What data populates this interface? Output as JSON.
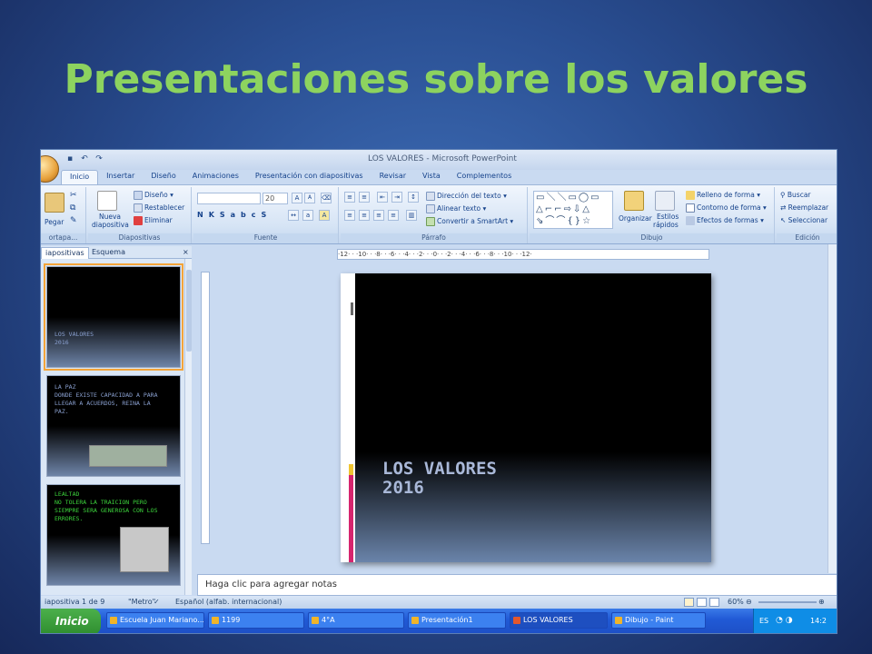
{
  "page": {
    "title": "Presentaciones sobre los valores"
  },
  "window": {
    "title": "LOS VALORES - Microsoft PowerPoint"
  },
  "ribbon_tabs": [
    "Inicio",
    "Insertar",
    "Diseño",
    "Animaciones",
    "Presentación con diapositivas",
    "Revisar",
    "Vista",
    "Complementos"
  ],
  "ribbon": {
    "portapapeles": {
      "label": "ortapa...",
      "pegar": "Pegar"
    },
    "diapositivas": {
      "label": "Diapositivas",
      "nueva_line1": "Nueva",
      "nueva_line2": "diapositiva",
      "diseno": "Diseño",
      "restablecer": "Restablecer",
      "eliminar": "Eliminar"
    },
    "fuente": {
      "label": "Fuente",
      "size": "20",
      "grow": "A",
      "shrink": "A"
    },
    "parrafo": {
      "label": "Párrafo",
      "direccion": "Dirección del texto",
      "alinear": "Alinear texto",
      "convertir": "Convertir a SmartArt"
    },
    "dibujo": {
      "label": "Dibujo",
      "organizar": "Organizar",
      "estilos_line1": "Estilos",
      "estilos_line2": "rápidos",
      "relleno": "Relleno de forma",
      "contorno": "Contorno de forma",
      "efectos": "Efectos de formas"
    },
    "edicion": {
      "label": "Edición",
      "buscar": "Buscar",
      "reemplazar": "Reemplazar",
      "seleccionar": "Seleccionar"
    }
  },
  "panel_tabs": {
    "diapositivas": "iapositivas",
    "esquema": "Esquema"
  },
  "thumbnails": [
    {
      "lines": "LOS VALORES\n2016",
      "color": "#8aa0d0"
    },
    {
      "lines": "LA PAZ\nDONDE EXISTE CAPACIDAD A PARA\nLLEGAR A ACUERDOS, REINA LA\nPAZ.",
      "color": "#8aa0d0"
    },
    {
      "lines": "LEALTAD\nNO TOLERA LA TRAICION PERO\nSIEMPRE SERA GENEROSA CON LOS\nERRORES.",
      "color": "#3cd43c"
    }
  ],
  "ruler_h": "·12· · ·10· · ·8· · ·6· · ·4· · ·2· · ·0· · ·2· · ·4· · ·6· · ·8· · ·10· · ·12·",
  "main_slide": {
    "title": "LOS VALORES\n2016"
  },
  "notes": {
    "placeholder": "Haga clic para agregar notas"
  },
  "status": {
    "slide": "iapositiva 1 de 9",
    "theme": "\"Metro\"",
    "language": "Español (alfab. internacional)",
    "zoom": "60%"
  },
  "taskbar": {
    "start": "Inicio",
    "items": [
      "Escuela Juan Mariano...",
      "1199",
      "4°A",
      "Presentación1",
      "LOS VALORES",
      "Dibujo - Paint"
    ],
    "lang": "ES",
    "clock": "14:2"
  }
}
